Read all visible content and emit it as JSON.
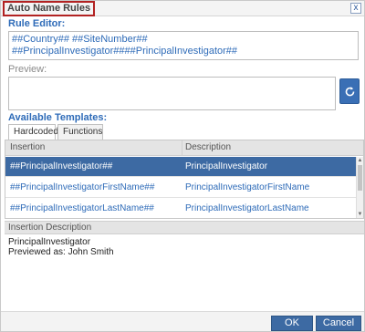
{
  "window": {
    "title": "Auto Name Rules",
    "close_label": "x"
  },
  "rule_editor": {
    "label": "Rule Editor:",
    "value": "##Country## ##SiteNumber## ##PrincipalInvestigator####PrincipalInvestigator##"
  },
  "preview": {
    "label": "Preview:",
    "value": ""
  },
  "templates": {
    "label": "Available Templates:",
    "tabs": [
      {
        "label": "Hardcoded",
        "active": true
      },
      {
        "label": "Functions",
        "active": false
      }
    ],
    "columns": [
      "Insertion",
      "Description"
    ],
    "rows": [
      {
        "insertion": "##PrincipalInvestigator##",
        "description": "PrincipalInvestigator",
        "selected": true
      },
      {
        "insertion": "##PrincipalInvestigatorFirstName##",
        "description": "PrincipalInvestigatorFirstName",
        "selected": false
      },
      {
        "insertion": "##PrincipalInvestigatorLastName##",
        "description": "PrincipalInvestigatorLastName",
        "selected": false
      }
    ]
  },
  "insertion_description": {
    "header": "Insertion Description",
    "line1": "PrincipalInvestigator",
    "line2": "Previewed as:  John Smith"
  },
  "buttons": {
    "ok": "OK",
    "cancel": "Cancel"
  },
  "colors": {
    "accent": "#2e6bb8",
    "selected_row": "#3d6aa3",
    "title_highlight": "#b22222"
  }
}
